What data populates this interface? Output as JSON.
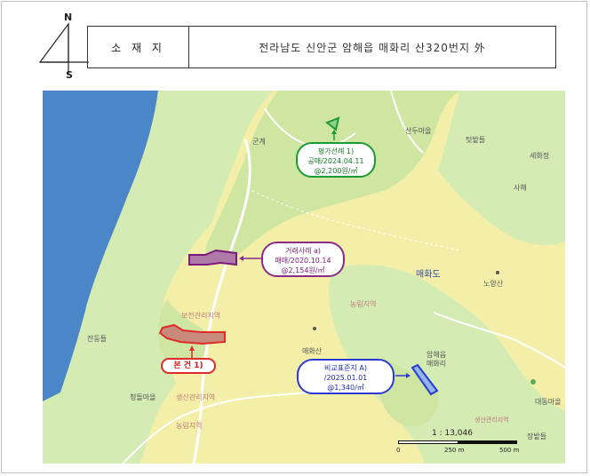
{
  "compass": {
    "north": "N",
    "south": "S"
  },
  "location": {
    "key": "소 재 지",
    "value": "전라남도 신안군 암해읍 매화리 산320번지 外"
  },
  "places": {
    "gungye": "군계",
    "sandu": "산두마을",
    "teotbat": "텃밭들",
    "sehwa": "세화정",
    "sahae": "사해",
    "maehwado": "매화도",
    "noyangsan": "노양산",
    "nongrim": "농림지역",
    "bojeon": "보전관리지역",
    "jandeung": "잔등들",
    "maehwasan": "매화산",
    "amhae_a": "암해읍",
    "amhae_b": "매화리",
    "cheongdol": "청돌마을",
    "saengsan1": "생산관리지역",
    "nongrim2": "농림지역",
    "saengsan2": "생산관리지역",
    "daedong": "대동마을",
    "jangbat": "장밭들"
  },
  "callouts": {
    "appraisal": {
      "line1": "평가선례 1)",
      "line2": "공매/2024.04.11",
      "line3": "@2,200원/㎡"
    },
    "transaction": {
      "line1": "거래사례 a)",
      "line2": "매매/2020.10.14",
      "line3": "@2,154원/㎡"
    },
    "subject": {
      "line1": "본 건 1)"
    },
    "comparable": {
      "line1": "비교표준지 A)",
      "line2": "/2025.01.01",
      "line3": "@1,340/㎡"
    }
  },
  "scale": {
    "ratio": "1 : 13,046",
    "tick_0": "0",
    "tick_250": "250 m",
    "tick_500": "500 m"
  },
  "colors": {
    "sea": "#4a86c8",
    "agri": "#cfe6a3",
    "mgmt": "#f4efa8",
    "forest": "#d4ebb4",
    "green": "#1a9a33",
    "purple": "#8a2a8a",
    "red": "#e02a2a",
    "blue": "#2a3ad0"
  }
}
